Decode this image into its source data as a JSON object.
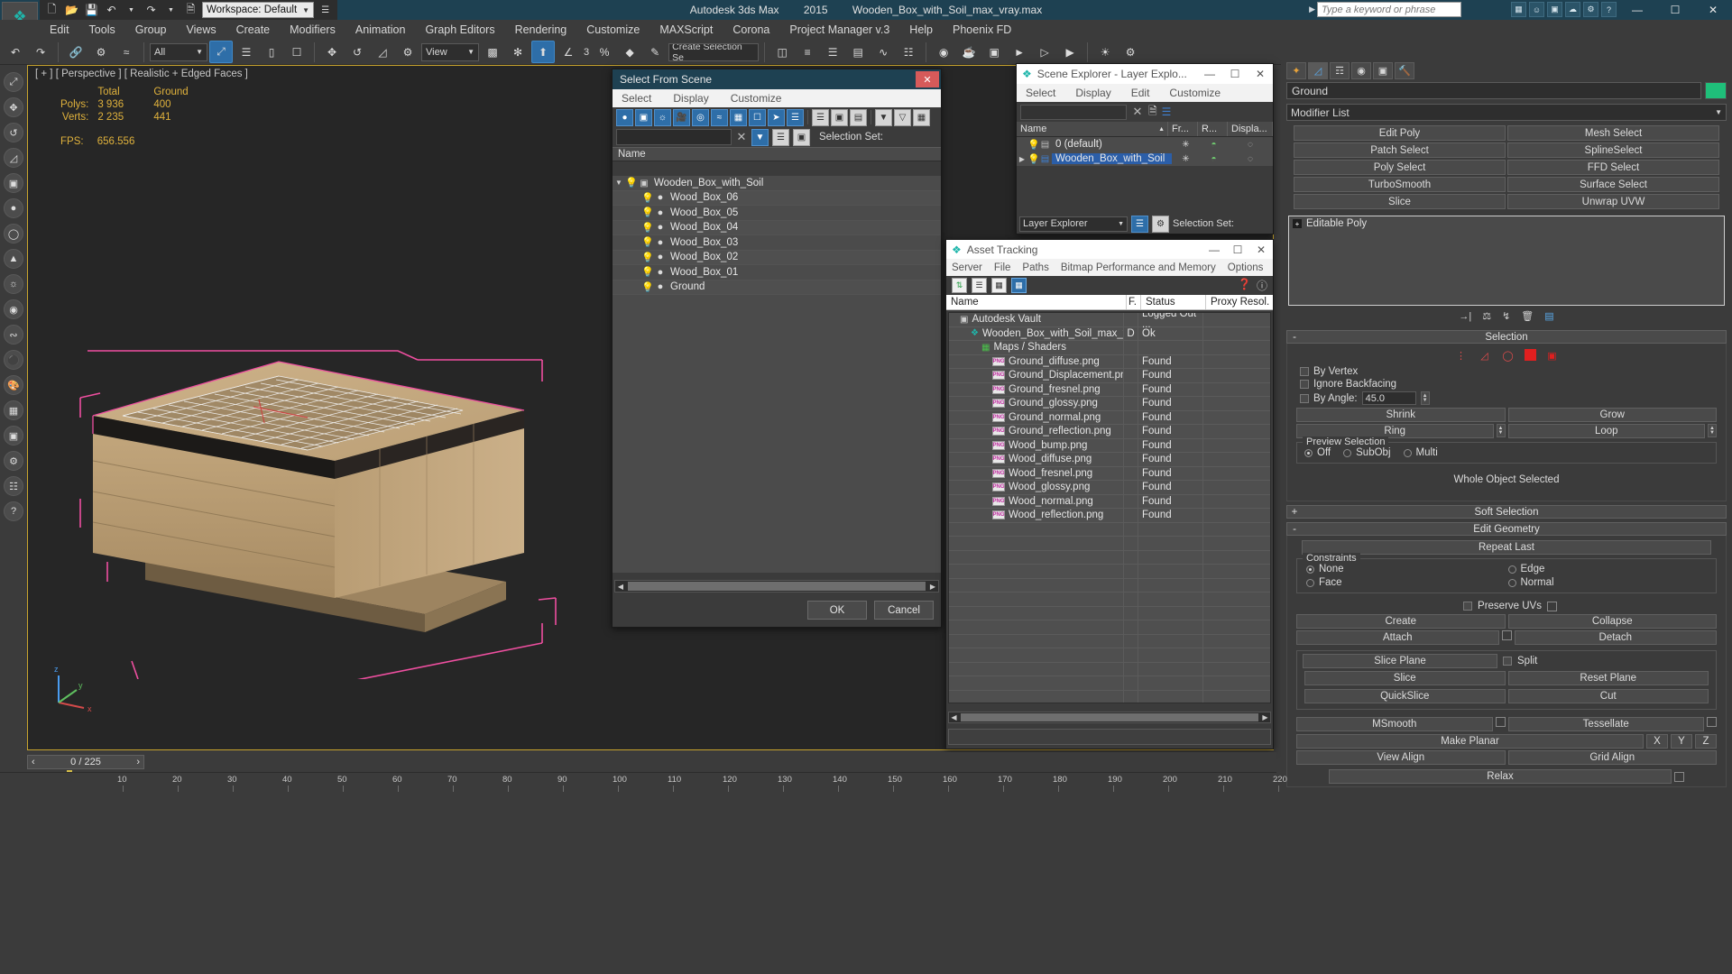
{
  "titlebar": {
    "app_name": "Autodesk 3ds Max",
    "version": "2015",
    "file_name": "Wooden_Box_with_Soil_max_vray.max",
    "search_placeholder": "Type a keyword or phrase",
    "workspace_label": "Workspace: Default",
    "minimize": "—",
    "maximize": "☐",
    "close": "✕"
  },
  "menubar": {
    "items": [
      "Edit",
      "Tools",
      "Group",
      "Views",
      "Create",
      "Modifiers",
      "Animation",
      "Graph Editors",
      "Rendering",
      "Customize",
      "MAXScript",
      "Corona",
      "Project Manager v.3",
      "Help",
      "Phoenix FD"
    ]
  },
  "toolbar": {
    "selection_filter": "All",
    "ref_coord_system": "View",
    "named_selection_set": "Create Selection Se",
    "angle_snap_value": "3"
  },
  "viewport": {
    "label": "[ + ] [ Perspective ] [ Realistic + Edged Faces ]",
    "stats": {
      "col_total": "Total",
      "col_object": "Ground",
      "polys_label": "Polys:",
      "polys_total": "3 936",
      "polys_object": "400",
      "verts_label": "Verts:",
      "verts_total": "2 235",
      "verts_object": "441",
      "fps_label": "FPS:",
      "fps_value": "656.556"
    }
  },
  "select_from_scene": {
    "title": "Select From Scene",
    "menu": [
      "Select",
      "Display",
      "Customize"
    ],
    "find_value": "",
    "selection_set_label": "Selection Set:",
    "column_name": "Name",
    "rows": [
      {
        "name": "Wooden_Box_with_Soil",
        "level": 0,
        "expanded": true
      },
      {
        "name": "Wood_Box_06",
        "level": 1,
        "expanded": false
      },
      {
        "name": "Wood_Box_05",
        "level": 1,
        "expanded": false
      },
      {
        "name": "Wood_Box_04",
        "level": 1,
        "expanded": false
      },
      {
        "name": "Wood_Box_03",
        "level": 1,
        "expanded": false
      },
      {
        "name": "Wood_Box_02",
        "level": 1,
        "expanded": false
      },
      {
        "name": "Wood_Box_01",
        "level": 1,
        "expanded": false
      },
      {
        "name": "Ground",
        "level": 1,
        "expanded": false
      }
    ],
    "ok_label": "OK",
    "cancel_label": "Cancel"
  },
  "scene_explorer": {
    "title": "Scene Explorer - Layer Explo...",
    "menu": [
      "Select",
      "Display",
      "Edit",
      "Customize"
    ],
    "find_value": "",
    "columns": [
      "Name",
      "Fr...",
      "R...",
      "Displa..."
    ],
    "rows": [
      {
        "name": "0 (default)",
        "selected": false,
        "expandable": false
      },
      {
        "name": "Wooden_Box_with_Soil",
        "selected": true,
        "expandable": true
      }
    ],
    "mode": "Layer Explorer",
    "selection_set_label": "Selection Set:"
  },
  "asset_tracking": {
    "title": "Asset Tracking",
    "menu": [
      "Server",
      "File",
      "Paths",
      "Bitmap Performance and Memory",
      "Options"
    ],
    "columns": [
      "Name",
      "F.",
      "Status",
      "Proxy Resol."
    ],
    "rows": [
      {
        "name": "Autodesk Vault",
        "icon": "vault-icon",
        "f": "",
        "status": "Logged Out ...",
        "proxy": "",
        "indent": 1
      },
      {
        "name": "Wooden_Box_with_Soil_max_vray....",
        "icon": "max-icon",
        "f": "D",
        "status": "Ok",
        "proxy": "",
        "indent": 2
      },
      {
        "name": "Maps / Shaders",
        "icon": "maps-icon",
        "f": "",
        "status": "",
        "proxy": "",
        "indent": 3
      },
      {
        "name": "Ground_diffuse.png",
        "icon": "png-icon",
        "f": "",
        "status": "Found",
        "proxy": "",
        "indent": 4
      },
      {
        "name": "Ground_Displacement.png",
        "icon": "png-icon",
        "f": "",
        "status": "Found",
        "proxy": "",
        "indent": 4
      },
      {
        "name": "Ground_fresnel.png",
        "icon": "png-icon",
        "f": "",
        "status": "Found",
        "proxy": "",
        "indent": 4
      },
      {
        "name": "Ground_glossy.png",
        "icon": "png-icon",
        "f": "",
        "status": "Found",
        "proxy": "",
        "indent": 4
      },
      {
        "name": "Ground_normal.png",
        "icon": "png-icon",
        "f": "",
        "status": "Found",
        "proxy": "",
        "indent": 4
      },
      {
        "name": "Ground_reflection.png",
        "icon": "png-icon",
        "f": "",
        "status": "Found",
        "proxy": "",
        "indent": 4
      },
      {
        "name": "Wood_bump.png",
        "icon": "png-icon",
        "f": "",
        "status": "Found",
        "proxy": "",
        "indent": 4
      },
      {
        "name": "Wood_diffuse.png",
        "icon": "png-icon",
        "f": "",
        "status": "Found",
        "proxy": "",
        "indent": 4
      },
      {
        "name": "Wood_fresnel.png",
        "icon": "png-icon",
        "f": "",
        "status": "Found",
        "proxy": "",
        "indent": 4
      },
      {
        "name": "Wood_glossy.png",
        "icon": "png-icon",
        "f": "",
        "status": "Found",
        "proxy": "",
        "indent": 4
      },
      {
        "name": "Wood_normal.png",
        "icon": "png-icon",
        "f": "",
        "status": "Found",
        "proxy": "",
        "indent": 4
      },
      {
        "name": "Wood_reflection.png",
        "icon": "png-icon",
        "f": "",
        "status": "Found",
        "proxy": "",
        "indent": 4
      }
    ]
  },
  "command_panel": {
    "object_name": "Ground",
    "object_color": "#1fbf7a",
    "modifier_list_label": "Modifier List",
    "modifier_buttons": [
      "Edit Poly",
      "Mesh Select",
      "Patch Select",
      "SplineSelect",
      "Poly Select",
      "FFD Select",
      "TurboSmooth",
      "Surface Select",
      "Slice",
      "Unwrap UVW"
    ],
    "stack": [
      {
        "label": "Editable Poly"
      }
    ],
    "selection": {
      "title": "Selection",
      "by_vertex": "By Vertex",
      "ignore_backfacing": "Ignore Backfacing",
      "by_angle": "By Angle:",
      "by_angle_value": "45.0",
      "shrink": "Shrink",
      "grow": "Grow",
      "ring": "Ring",
      "loop": "Loop",
      "preview_selection": "Preview Selection",
      "preview_off": "Off",
      "preview_subobj": "SubObj",
      "preview_multi": "Multi",
      "status": "Whole Object Selected"
    },
    "soft_selection": {
      "title": "Soft Selection"
    },
    "edit_geometry": {
      "title": "Edit Geometry",
      "repeat_last": "Repeat Last",
      "constraints": "Constraints",
      "none": "None",
      "edge": "Edge",
      "face": "Face",
      "normal": "Normal",
      "preserve_uvs": "Preserve UVs",
      "create": "Create",
      "collapse": "Collapse",
      "attach": "Attach",
      "detach": "Detach",
      "slice_plane": "Slice Plane",
      "split": "Split",
      "slice": "Slice",
      "reset_plane": "Reset Plane",
      "quickslice": "QuickSlice",
      "cut": "Cut",
      "msmooth": "MSmooth",
      "tessellate": "Tessellate",
      "make_planar": "Make Planar",
      "x": "X",
      "y": "Y",
      "z": "Z",
      "view_align": "View Align",
      "grid_align": "Grid Align",
      "relax": "Relax"
    }
  },
  "timeline": {
    "frame_display": "0 / 225",
    "prev_arrow": "‹",
    "next_arrow": "›",
    "ticks": [
      "10",
      "20",
      "30",
      "40",
      "50",
      "60",
      "70",
      "80",
      "90",
      "100",
      "110",
      "120",
      "130",
      "140",
      "150",
      "160",
      "170",
      "180",
      "190",
      "200",
      "210",
      "220"
    ]
  }
}
